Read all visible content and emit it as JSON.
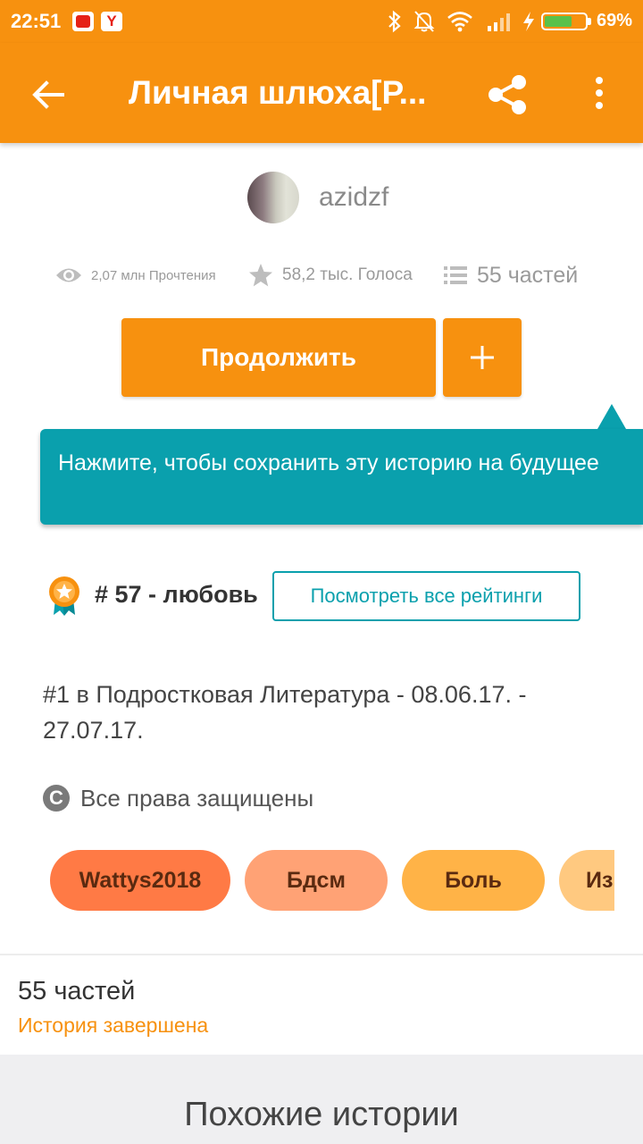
{
  "status_bar": {
    "time": "22:51",
    "notifications": [
      "youtube-icon",
      "yandex-icon"
    ],
    "yandex_letter": "Y",
    "system_icons": [
      "bluetooth-icon",
      "mute-icon",
      "wifi-icon",
      "signal-icon",
      "charging-icon"
    ],
    "battery_level": 0.69,
    "battery_text": "69%"
  },
  "app_bar": {
    "title": "Личная шлюха[Р..."
  },
  "author": {
    "name": "azidzf"
  },
  "stats": {
    "views": "2,07 млн Прочтения",
    "votes": "58,2 тыс. Голоса",
    "parts": "55 частей"
  },
  "actions": {
    "continue_label": "Продолжить"
  },
  "tooltip": {
    "text": "Нажмите, чтобы сохранить эту историю на будущее"
  },
  "ranking": {
    "text": "# 57 - любовь",
    "button_label": "Посмотреть все рейтинги"
  },
  "description": "#1 в Подростковая Литература - 08.06.17. - 27.07.17.",
  "copyright": {
    "symbol": "C",
    "text": "Все права защищены"
  },
  "tags": [
    {
      "label": "Wattys2018",
      "color": "#ff7a45"
    },
    {
      "label": "Бдсм",
      "color": "#ffa275"
    },
    {
      "label": "Боль",
      "color": "#ffb347"
    },
    {
      "label": "Из",
      "color": "#ffc980"
    }
  ],
  "parts_section": {
    "title": "55 частей",
    "status": "История завершена"
  },
  "similar": {
    "title": "Похожие истории"
  },
  "colors": {
    "accent": "#f7910f",
    "teal": "#0aa0ad"
  }
}
